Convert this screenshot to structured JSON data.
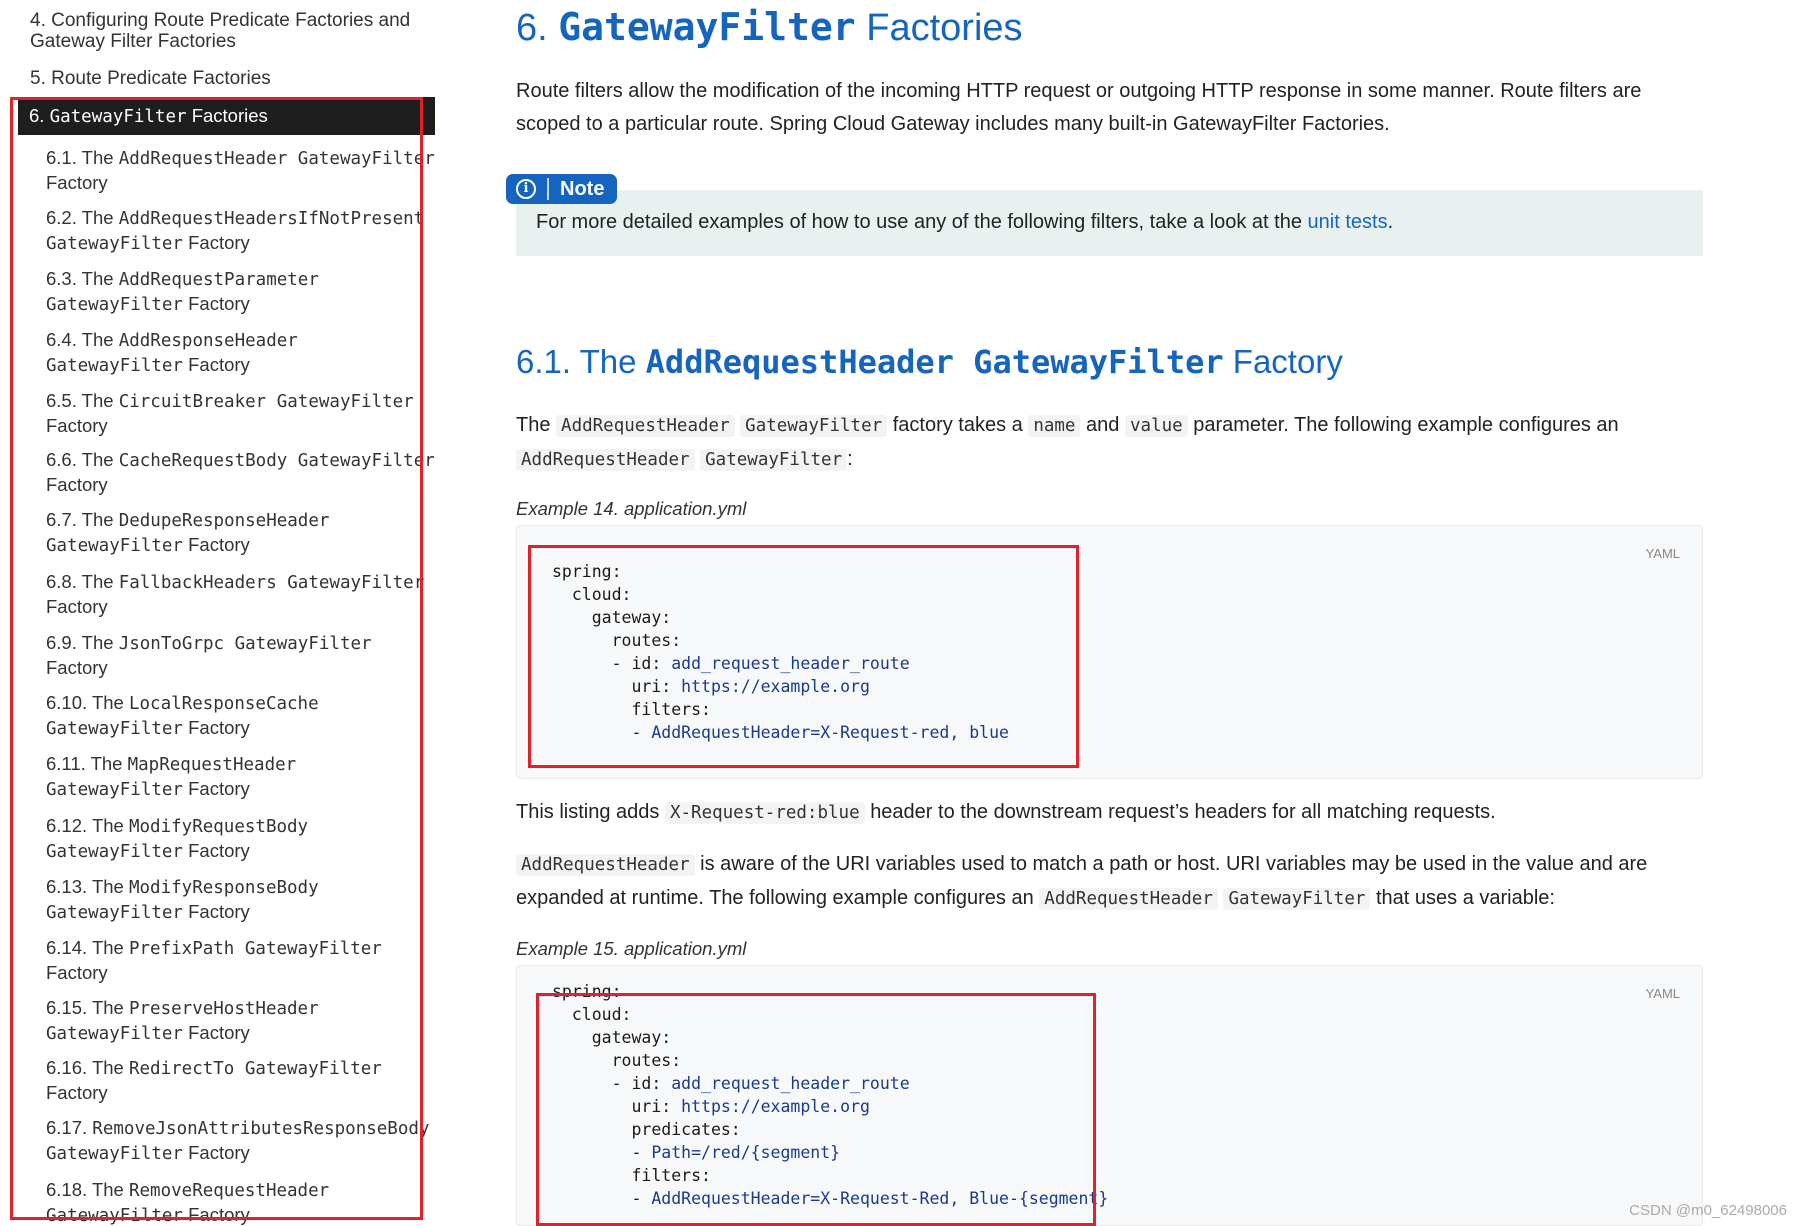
{
  "toc": {
    "top_items": [
      "4. Configuring Route Predicate Factories and Gateway Filter Factories",
      "5. Route Predicate Factories"
    ],
    "active_item": {
      "num": "6.",
      "code": "GatewayFilter",
      "label": "Factories"
    },
    "sub_items": [
      {
        "num": "6.1. The",
        "code": "AddRequestHeader GatewayFilter",
        "rest": "Factory"
      },
      {
        "num": "6.2. The",
        "code": "AddRequestHeadersIfNotPresent GatewayFilter",
        "rest": "Factory"
      },
      {
        "num": "6.3. The",
        "code": "AddRequestParameter GatewayFilter",
        "rest": "Factory"
      },
      {
        "num": "6.4. The",
        "code": "AddResponseHeader GatewayFilter",
        "rest": "Factory"
      },
      {
        "num": "6.5. The",
        "code": "CircuitBreaker GatewayFilter",
        "rest": "Factory"
      },
      {
        "num": "6.6. The",
        "code": "CacheRequestBody GatewayFilter",
        "rest": "Factory"
      },
      {
        "num": "6.7. The",
        "code": "DedupeResponseHeader GatewayFilter",
        "rest": "Factory"
      },
      {
        "num": "6.8. The",
        "code": "FallbackHeaders GatewayFilter",
        "rest": "Factory"
      },
      {
        "num": "6.9. The",
        "code": "JsonToGrpc GatewayFilter",
        "rest": "Factory"
      },
      {
        "num": "6.10. The",
        "code": "LocalResponseCache GatewayFilter",
        "rest": "Factory"
      },
      {
        "num": "6.11. The",
        "code": "MapRequestHeader GatewayFilter",
        "rest": "Factory"
      },
      {
        "num": "6.12. The",
        "code": "ModifyRequestBody GatewayFilter",
        "rest": "Factory"
      },
      {
        "num": "6.13. The",
        "code": "ModifyResponseBody GatewayFilter",
        "rest": "Factory"
      },
      {
        "num": "6.14. The",
        "code": "PrefixPath GatewayFilter",
        "rest": "Factory"
      },
      {
        "num": "6.15. The",
        "code": "PreserveHostHeader GatewayFilter",
        "rest": "Factory"
      },
      {
        "num": "6.16. The",
        "code": "RedirectTo GatewayFilter",
        "rest": "Factory"
      },
      {
        "num": "6.17.",
        "code": "RemoveJsonAttributesResponseBody GatewayFilter",
        "rest": "Factory"
      },
      {
        "num": "6.18. The",
        "code": "RemoveRequestHeader GatewayFilter",
        "rest": "Factory"
      }
    ]
  },
  "main": {
    "title_num": "6.",
    "title_code": "GatewayFilter",
    "title_rest": "Factories",
    "intro": "Route filters allow the modification of the incoming HTTP request or outgoing HTTP response in some manner. Route filters are scoped to a particular route. Spring Cloud Gateway includes many built-in GatewayFilter Factories.",
    "note": {
      "label": "Note",
      "text": "For more detailed examples of how to use any of the following filters, take a look at the",
      "link": "unit tests",
      "end": "."
    },
    "sub_title_num": "6.1. The",
    "sub_title_code": "AddRequestHeader GatewayFilter",
    "sub_title_rest": "Factory",
    "p1": {
      "t1": "The",
      "c1": "AddRequestHeader",
      "c2": "GatewayFilter",
      "t2": "factory takes a",
      "c3": "name",
      "t3": "and",
      "c4": "value",
      "t4": "parameter. The following example configures an",
      "c5": "AddRequestHeader",
      "c6": "GatewayFilter",
      "t5": ":"
    },
    "example14": {
      "title": "Example 14. application.yml",
      "lang": "YAML",
      "lines": [
        "spring:",
        "  cloud:",
        "    gateway:",
        "      routes:",
        "      - id: add_request_header_route",
        "        uri: https://example.org",
        "        filters:",
        "        - AddRequestHeader=X-Request-red, blue"
      ]
    },
    "p2": {
      "t1": "This listing adds",
      "c1": "X-Request-red:blue",
      "t2": "header to the downstream request’s headers for all matching requests."
    },
    "p3": {
      "c1": "AddRequestHeader",
      "t1": "is aware of the URI variables used to match a path or host. URI variables may be used in the value and are expanded at runtime. The following example configures an",
      "c2": "AddRequestHeader",
      "c3": "GatewayFilter",
      "t2": "that uses a variable:"
    },
    "example15": {
      "title": "Example 15. application.yml",
      "lang": "YAML",
      "lines": [
        "spring:",
        "  cloud:",
        "    gateway:",
        "      routes:",
        "      - id: add_request_header_route",
        "        uri: https://example.org",
        "        predicates:",
        "        - Path=/red/{segment}",
        "        filters:",
        "        - AddRequestHeader=X-Request-Red, Blue-{segment}"
      ]
    }
  },
  "watermark": "CSDN @m0_62498006",
  "colors": {
    "accent": "#1565c0",
    "highlight_box": "#e0222a",
    "note_bg": "#e8f1f0"
  }
}
